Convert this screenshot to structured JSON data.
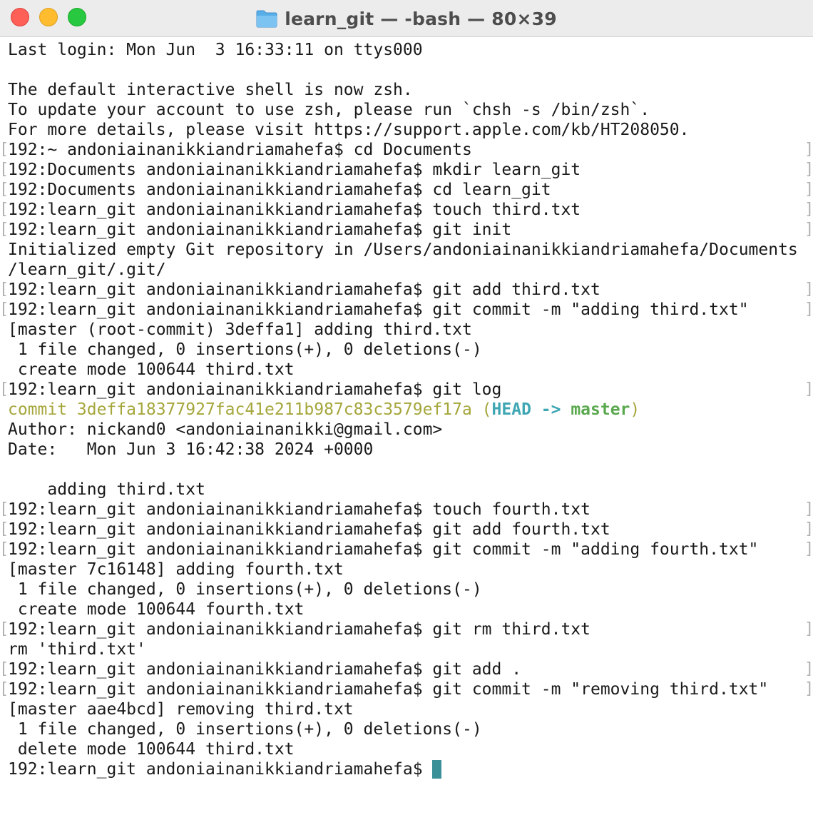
{
  "window": {
    "title": "learn_git — -bash — 80×39"
  },
  "terminal": {
    "lines": [
      {
        "text": "Last login: Mon Jun  3 16:33:11 on ttys000",
        "marked": false
      },
      {
        "text": "",
        "marked": false
      },
      {
        "text": "The default interactive shell is now zsh.",
        "marked": false
      },
      {
        "text": "To update your account to use zsh, please run `chsh -s /bin/zsh`.",
        "marked": false
      },
      {
        "text": "For more details, please visit https://support.apple.com/kb/HT208050.",
        "marked": false
      },
      {
        "text": "192:~ andoniainanikkiandriamahefa$ cd Documents",
        "marked": true
      },
      {
        "text": "192:Documents andoniainanikkiandriamahefa$ mkdir learn_git",
        "marked": true
      },
      {
        "text": "192:Documents andoniainanikkiandriamahefa$ cd learn_git",
        "marked": true
      },
      {
        "text": "192:learn_git andoniainanikkiandriamahefa$ touch third.txt",
        "marked": true
      },
      {
        "text": "192:learn_git andoniainanikkiandriamahefa$ git init",
        "marked": true
      },
      {
        "text": "Initialized empty Git repository in /Users/andoniainanikkiandriamahefa/Documents",
        "marked": false
      },
      {
        "text": "/learn_git/.git/",
        "marked": false
      },
      {
        "text": "192:learn_git andoniainanikkiandriamahefa$ git add third.txt",
        "marked": true
      },
      {
        "text": "192:learn_git andoniainanikkiandriamahefa$ git commit -m \"adding third.txt\"",
        "marked": true
      },
      {
        "text": "[master (root-commit) 3deffa1] adding third.txt",
        "marked": false
      },
      {
        "text": " 1 file changed, 0 insertions(+), 0 deletions(-)",
        "marked": false
      },
      {
        "text": " create mode 100644 third.txt",
        "marked": false
      },
      {
        "text": "192:learn_git andoniainanikkiandriamahefa$ git log",
        "marked": true
      },
      {
        "segments": [
          {
            "text": "commit 3deffa18377927fac41e211b987c83c3579ef17a ",
            "color": "yellow"
          },
          {
            "text": "(",
            "color": "yellow"
          },
          {
            "text": "HEAD -> ",
            "color": "cyan"
          },
          {
            "text": "master",
            "color": "green"
          },
          {
            "text": ")",
            "color": "yellow"
          }
        ],
        "marked": false
      },
      {
        "text": "Author: nickand0 <andoniainanikki@gmail.com>",
        "marked": false
      },
      {
        "text": "Date:   Mon Jun 3 16:42:38 2024 +0000",
        "marked": false
      },
      {
        "text": "",
        "marked": false
      },
      {
        "text": "    adding third.txt",
        "marked": false
      },
      {
        "text": "192:learn_git andoniainanikkiandriamahefa$ touch fourth.txt",
        "marked": true
      },
      {
        "text": "192:learn_git andoniainanikkiandriamahefa$ git add fourth.txt",
        "marked": true
      },
      {
        "text": "192:learn_git andoniainanikkiandriamahefa$ git commit -m \"adding fourth.txt\"",
        "marked": true
      },
      {
        "text": "[master 7c16148] adding fourth.txt",
        "marked": false
      },
      {
        "text": " 1 file changed, 0 insertions(+), 0 deletions(-)",
        "marked": false
      },
      {
        "text": " create mode 100644 fourth.txt",
        "marked": false
      },
      {
        "text": "192:learn_git andoniainanikkiandriamahefa$ git rm third.txt",
        "marked": true
      },
      {
        "text": "rm 'third.txt'",
        "marked": false
      },
      {
        "text": "192:learn_git andoniainanikkiandriamahefa$ git add .",
        "marked": true
      },
      {
        "text": "192:learn_git andoniainanikkiandriamahefa$ git commit -m \"removing third.txt\"",
        "marked": true
      },
      {
        "text": "[master aae4bcd] removing third.txt",
        "marked": false
      },
      {
        "text": " 1 file changed, 0 insertions(+), 0 deletions(-)",
        "marked": false
      },
      {
        "text": " delete mode 100644 third.txt",
        "marked": false
      }
    ],
    "prompt": "192:learn_git andoniainanikkiandriamahefa$ ",
    "mark_left": "[",
    "mark_right": "]"
  },
  "colors": {
    "yellow": "#a5a63b",
    "cyan": "#3fa6b4",
    "green": "#59a84d",
    "cursor": "#3b8f96"
  },
  "icons": {
    "title_icon": "folder-icon"
  }
}
